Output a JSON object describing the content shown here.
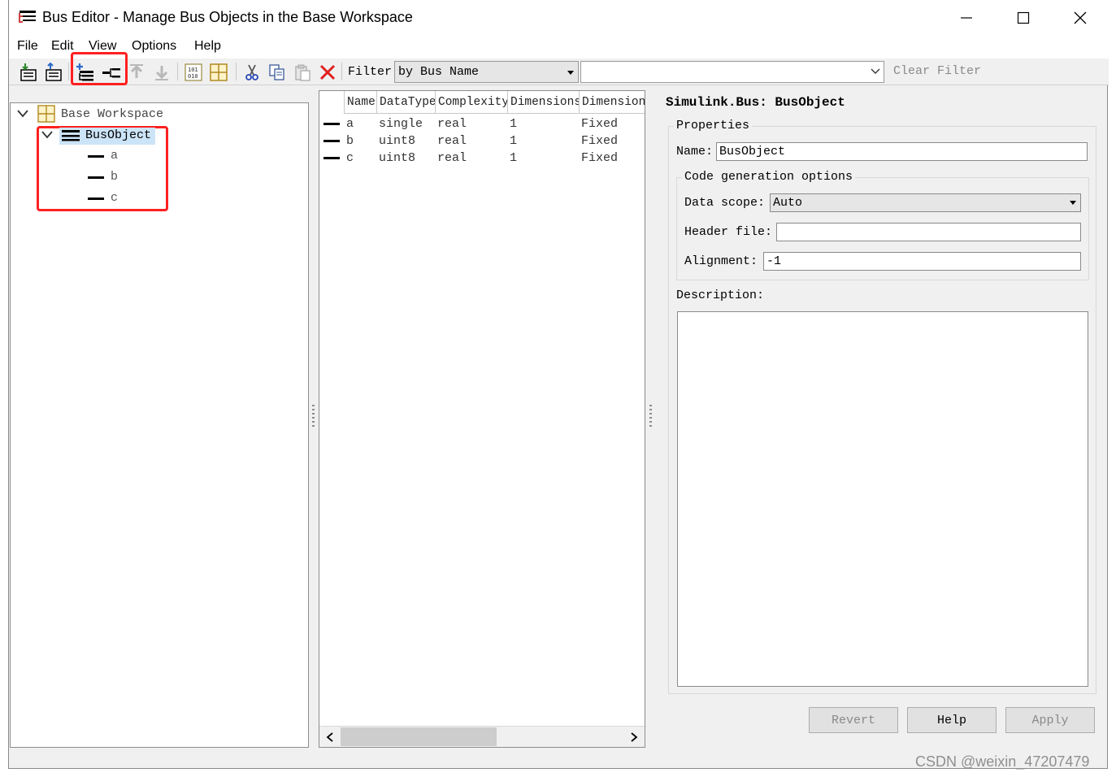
{
  "window": {
    "title": "Bus Editor - Manage Bus Objects in the Base Workspace"
  },
  "menu": [
    "File",
    "Edit",
    "View",
    "Options",
    "Help"
  ],
  "toolbar": {
    "filter_label": "Filter:",
    "filter_by": "by Bus Name",
    "filter_text": "",
    "clear_filter": "Clear Filter",
    "highlight_color": "#ff2020"
  },
  "tree": {
    "root": "Base Workspace",
    "bus": "BusObject",
    "elements": [
      "a",
      "b",
      "c"
    ],
    "selected_color": "#cce4f7"
  },
  "grid": {
    "headers": [
      "Name",
      "DataType",
      "Complexity",
      "Dimensions",
      "Dimensions"
    ],
    "rows": [
      {
        "name": "a",
        "datatype": "single",
        "complexity": "real",
        "dimensions": "1",
        "dimensions_mode": "Fixed"
      },
      {
        "name": "b",
        "datatype": "uint8",
        "complexity": "real",
        "dimensions": "1",
        "dimensions_mode": "Fixed"
      },
      {
        "name": "c",
        "datatype": "uint8",
        "complexity": "real",
        "dimensions": "1",
        "dimensions_mode": "Fixed"
      }
    ]
  },
  "properties": {
    "heading": "Simulink.Bus: BusObject",
    "group_label": "Properties",
    "name_label": "Name:",
    "name_value": "BusObject",
    "codegen_label": "Code generation options",
    "data_scope_label": "Data scope:",
    "data_scope_value": "Auto",
    "header_file_label": "Header file:",
    "header_file_value": "",
    "alignment_label": "Alignment:",
    "alignment_value": "-1",
    "description_label": "Description:",
    "description_value": ""
  },
  "buttons": {
    "revert": "Revert",
    "help": "Help",
    "apply": "Apply"
  },
  "watermark": "CSDN @weixin_47207479"
}
